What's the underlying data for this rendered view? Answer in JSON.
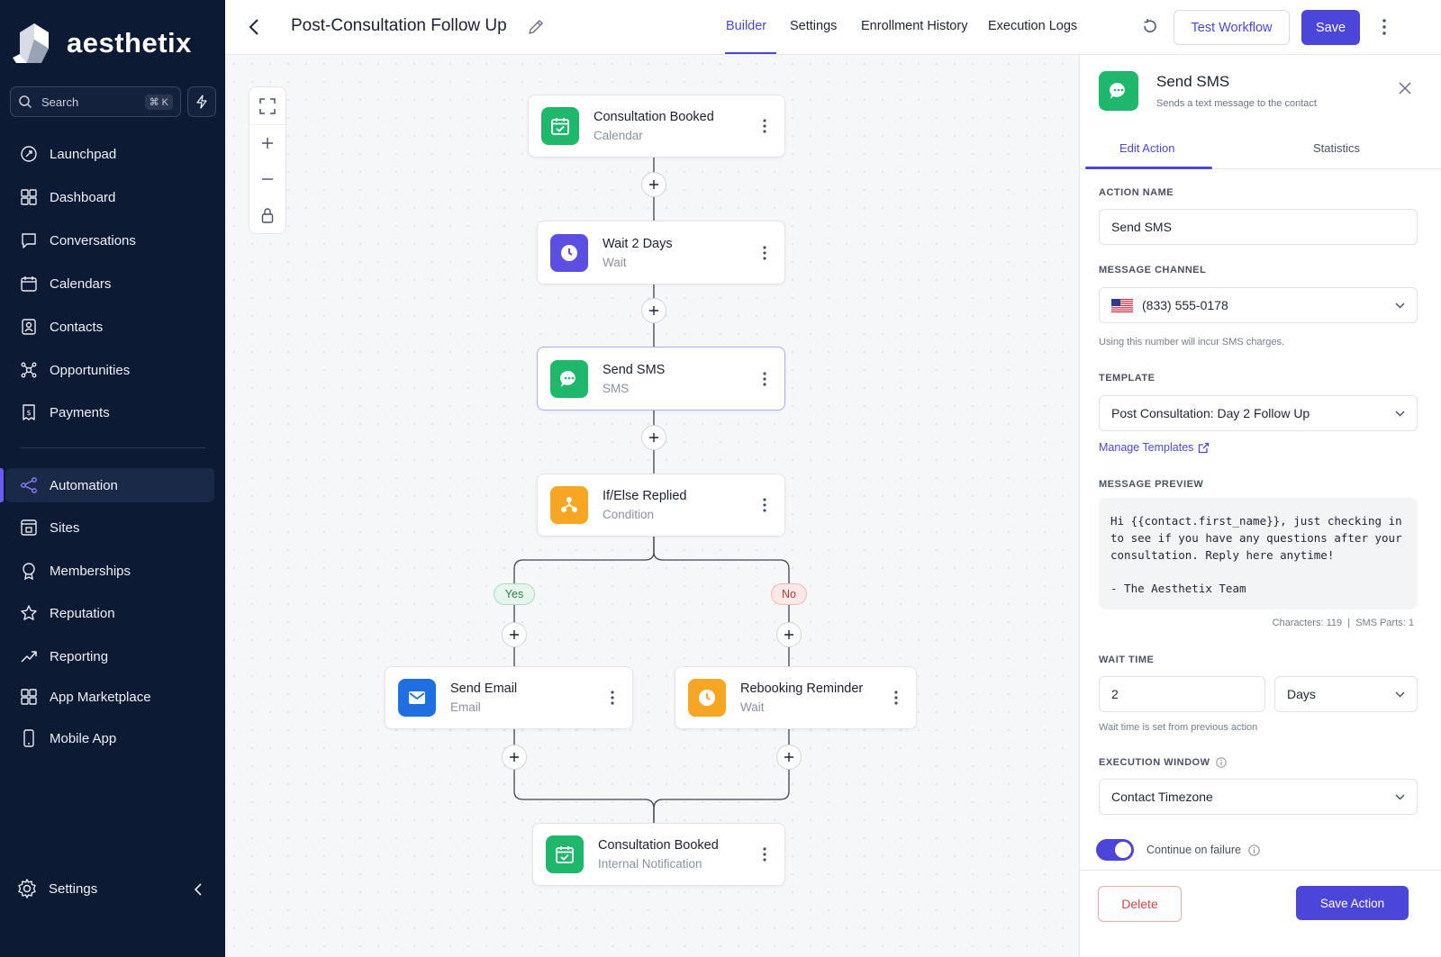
{
  "brand": {
    "name": "aesthetix"
  },
  "search": {
    "placeholder": "Search",
    "shortcut": "⌘ K"
  },
  "sidebar": {
    "items": [
      {
        "label": "Launchpad",
        "icon": "launchpad-icon"
      },
      {
        "label": "Dashboard",
        "icon": "dashboard-icon"
      },
      {
        "label": "Conversations",
        "icon": "chat-icon"
      },
      {
        "label": "Calendars",
        "icon": "calendar-icon"
      },
      {
        "label": "Contacts",
        "icon": "contacts-icon"
      },
      {
        "label": "Opportunities",
        "icon": "opportunities-icon"
      },
      {
        "label": "Payments",
        "icon": "payments-icon"
      },
      {
        "label": "Automation",
        "icon": "automation-icon",
        "active": true
      },
      {
        "label": "Sites",
        "icon": "sites-icon"
      },
      {
        "label": "Memberships",
        "icon": "memberships-icon"
      },
      {
        "label": "Reputation",
        "icon": "star-icon"
      },
      {
        "label": "Reporting",
        "icon": "reporting-icon"
      },
      {
        "label": "App Marketplace",
        "icon": "marketplace-icon"
      },
      {
        "label": "Mobile App",
        "icon": "mobile-icon"
      }
    ],
    "settings_label": "Settings"
  },
  "header": {
    "title": "Post-Consultation Follow Up",
    "tabs": [
      "Builder",
      "Settings",
      "Enrollment History",
      "Execution Logs"
    ],
    "active_tab": "Builder",
    "test_label": "Test Workflow",
    "save_label": "Save"
  },
  "workflow": {
    "nodes": [
      {
        "title": "Consultation Booked",
        "subtitle": "Calendar",
        "icon": "calendar-check-icon",
        "color": "#1fb86a"
      },
      {
        "title": "Wait 2 Days",
        "subtitle": "Wait",
        "icon": "clock-icon",
        "color": "#5b4ee0"
      },
      {
        "title": "Send SMS",
        "subtitle": "SMS",
        "icon": "chat-bubble-icon",
        "color": "#1fb86a",
        "selected": true
      },
      {
        "title": "If/Else Replied",
        "subtitle": "Condition",
        "icon": "branch-icon",
        "color": "#f6a623"
      },
      {
        "title": "Send Email",
        "subtitle": "Email",
        "icon": "mail-icon",
        "color": "#1f6fe0"
      },
      {
        "title": "Rebooking Reminder",
        "subtitle": "Wait",
        "icon": "clock-icon",
        "color": "#f6a623"
      },
      {
        "title": "Consultation Booked",
        "subtitle": "Internal Notification",
        "icon": "calendar-check-icon",
        "color": "#1fb86a"
      }
    ],
    "branch_yes": "Yes",
    "branch_no": "No"
  },
  "panel": {
    "title": "Send SMS",
    "subtitle": "Sends a text message to the contact",
    "tabs": [
      "Edit Action",
      "Statistics"
    ],
    "active_tab": "Edit Action",
    "action_name_label": "ACTION NAME",
    "action_name_value": "Send SMS",
    "channel_label": "MESSAGE CHANNEL",
    "channel_value": "(833) 555-0178",
    "channel_hint": "Using this number will incur SMS charges.",
    "template_label": "TEMPLATE",
    "template_value": "Post Consultation: Day 2 Follow Up",
    "manage_templates": "Manage Templates",
    "preview_label": "MESSAGE PREVIEW",
    "preview_lines": [
      "Hi {{contact.first_name}}, just checking in",
      "to see if you have any questions after your",
      "consultation. Reply here anytime!"
    ],
    "preview_signature": "- The Aesthetix Team",
    "characters": "Characters: 119",
    "sms_parts": "SMS Parts: 1",
    "wait_label": "WAIT TIME",
    "wait_value": "2",
    "wait_unit": "Days",
    "wait_hint": "Wait time is set from previous action",
    "exec_label": "EXECUTION WINDOW",
    "exec_value": "Contact Timezone",
    "continue_on_failure": "Continue on failure",
    "continue_on_failure_on": true,
    "delete_label": "Delete",
    "save_action_label": "Save Action"
  }
}
